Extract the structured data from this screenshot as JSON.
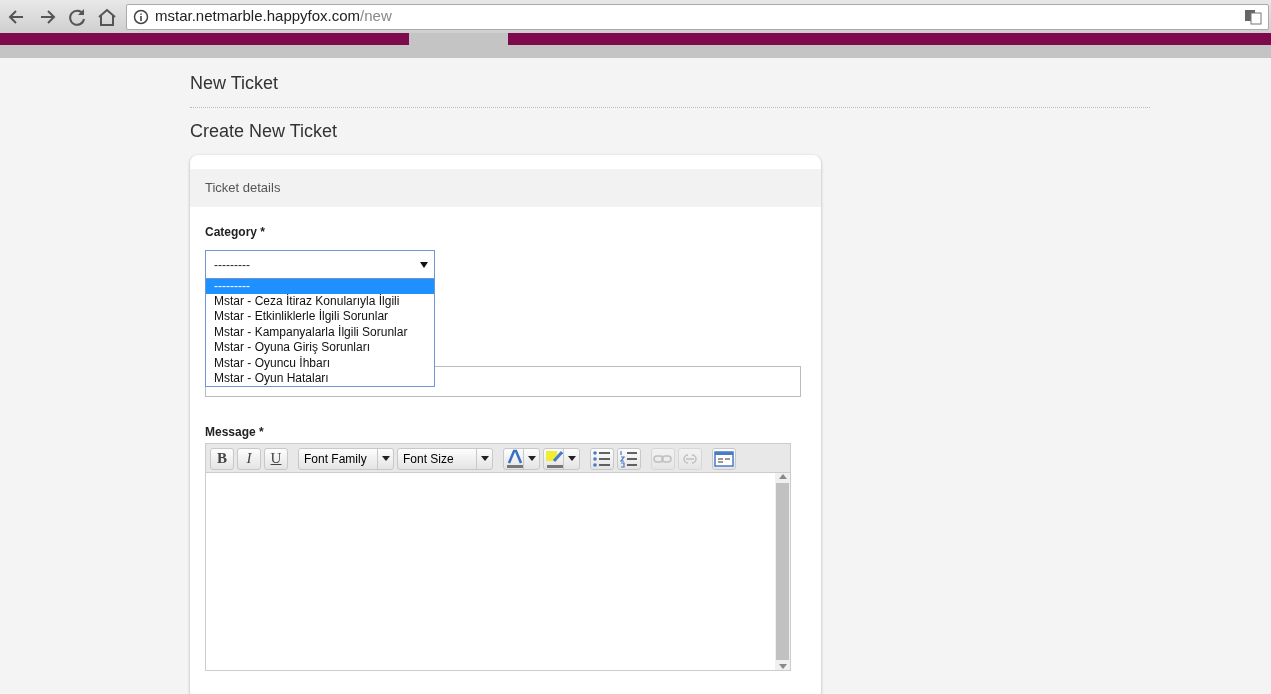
{
  "browser": {
    "url_host": "mstar.netmarble.happyfox.com",
    "url_path": "/new"
  },
  "page_title": "New Ticket",
  "section_title": "Create New Ticket",
  "card": {
    "header": "Ticket details",
    "category": {
      "label": "Category *",
      "value": "---------",
      "expanded": true,
      "options": [
        {
          "label": "---------",
          "selected": true
        },
        {
          "label": "Mstar - Ceza İtiraz Konularıyla İlgili",
          "selected": false
        },
        {
          "label": "Mstar - Etkinliklerle İlgili Sorunlar",
          "selected": false
        },
        {
          "label": "Mstar - Kampanyalarla İlgili Sorunlar",
          "selected": false
        },
        {
          "label": "Mstar - Oyuna Giriş Sorunları",
          "selected": false
        },
        {
          "label": "Mstar - Oyuncu İhbarı",
          "selected": false
        },
        {
          "label": "Mstar - Oyun Hataları",
          "selected": false
        }
      ]
    },
    "message": {
      "label": "Message *",
      "toolbar": [
        {
          "kind": "letter",
          "text": "B",
          "disabled": false
        },
        {
          "kind": "letter",
          "text": "I",
          "disabled": false
        },
        {
          "kind": "letter",
          "text": "U",
          "disabled": false
        },
        {
          "kind": "combo",
          "text": "Font Family",
          "disabled": false
        },
        {
          "kind": "combo",
          "text": "Font Size",
          "disabled": false
        },
        {
          "kind": "split",
          "disabled": false
        },
        {
          "kind": "split",
          "disabled": false
        },
        {
          "kind": "icon",
          "disabled": false
        },
        {
          "kind": "icon",
          "disabled": false
        },
        {
          "kind": "icon",
          "disabled": true
        },
        {
          "kind": "icon",
          "disabled": true
        },
        {
          "kind": "icon",
          "disabled": false
        }
      ]
    }
  }
}
